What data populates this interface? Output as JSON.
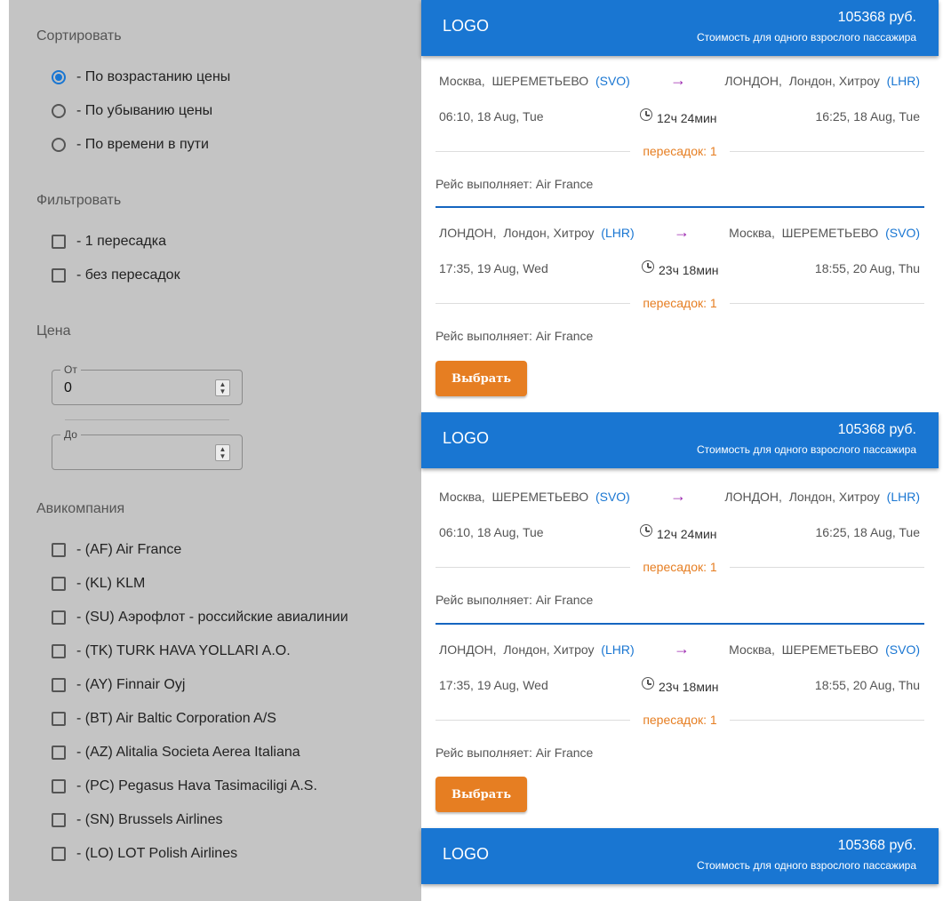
{
  "sort": {
    "title": "Сортировать",
    "options": [
      {
        "label": "- По возрастанию цены",
        "selected": true
      },
      {
        "label": "- По убыванию цены",
        "selected": false
      },
      {
        "label": "- По времени в пути",
        "selected": false
      }
    ]
  },
  "filter": {
    "title": "Фильтровать",
    "options": [
      {
        "label": "- 1 пересадка",
        "checked": false
      },
      {
        "label": "- без пересадок",
        "checked": false
      }
    ]
  },
  "price": {
    "title": "Цена",
    "from_label": "От",
    "from_value": "0",
    "to_label": "До",
    "to_value": ""
  },
  "airlines": {
    "title": "Авикомпания",
    "options": [
      {
        "label": "- (AF) Air France",
        "checked": false
      },
      {
        "label": "- (KL) KLM",
        "checked": false
      },
      {
        "label": "- (SU) Аэрофлот - российские авиалинии",
        "checked": false
      },
      {
        "label": "- (TK) TURK HAVA YOLLARI A.O.",
        "checked": false
      },
      {
        "label": "- (AY) Finnair Oyj",
        "checked": false
      },
      {
        "label": "- (BT) Air Baltic Corporation A/S",
        "checked": false
      },
      {
        "label": "- (AZ) Alitalia Societa Aerea Italiana",
        "checked": false
      },
      {
        "label": "- (PC) Pegasus Hava Tasimaciligi A.S.",
        "checked": false
      },
      {
        "label": "- (SN) Brussels Airlines",
        "checked": false
      },
      {
        "label": "- (LO) LOT Polish Airlines",
        "checked": false
      }
    ]
  },
  "cards": [
    {
      "logo": "LOGO",
      "price": "105368 руб.",
      "price_note": "Стоимость для одного взрослого пассажира",
      "choose_label": "Выбрать",
      "legs": [
        {
          "from_city": "Москва,",
          "from_airport": "ШЕРЕМЕТЬЕВО",
          "from_code": "(SVO)",
          "arrow": "→",
          "to_city": "ЛОНДОН,",
          "to_airport": "Лондон, Хитроу",
          "to_code": "(LHR)",
          "dep": "06:10, 18 Aug, Tue",
          "duration": "12ч 24мин",
          "arr": "16:25, 18 Aug, Tue",
          "stops": "пересадок: 1",
          "carrier": "Рейс выполняет: Air France"
        },
        {
          "from_city": "ЛОНДОН,",
          "from_airport": "Лондон, Хитроу",
          "from_code": "(LHR)",
          "arrow": "→",
          "to_city": "Москва,",
          "to_airport": "ШЕРЕМЕТЬЕВО",
          "to_code": "(SVO)",
          "dep": "17:35, 19 Aug, Wed",
          "duration": "23ч 18мин",
          "arr": "18:55, 20 Aug, Thu",
          "stops": "пересадок: 1",
          "carrier": "Рейс выполняет: Air France"
        }
      ]
    },
    {
      "logo": "LOGO",
      "price": "105368 руб.",
      "price_note": "Стоимость для одного взрослого пассажира",
      "choose_label": "Выбрать",
      "legs": [
        {
          "from_city": "Москва,",
          "from_airport": "ШЕРЕМЕТЬЕВО",
          "from_code": "(SVO)",
          "arrow": "→",
          "to_city": "ЛОНДОН,",
          "to_airport": "Лондон, Хитроу",
          "to_code": "(LHR)",
          "dep": "06:10, 18 Aug, Tue",
          "duration": "12ч 24мин",
          "arr": "16:25, 18 Aug, Tue",
          "stops": "пересадок: 1",
          "carrier": "Рейс выполняет: Air France"
        },
        {
          "from_city": "ЛОНДОН,",
          "from_airport": "Лондон, Хитроу",
          "from_code": "(LHR)",
          "arrow": "→",
          "to_city": "Москва,",
          "to_airport": "ШЕРЕМЕТЬЕВО",
          "to_code": "(SVO)",
          "dep": "17:35, 19 Aug, Wed",
          "duration": "23ч 18мин",
          "arr": "18:55, 20 Aug, Thu",
          "stops": "пересадок: 1",
          "carrier": "Рейс выполняет: Air France"
        }
      ]
    },
    {
      "logo": "LOGO",
      "price": "105368 руб.",
      "price_note": "Стоимость для одного взрослого пассажира"
    }
  ]
}
